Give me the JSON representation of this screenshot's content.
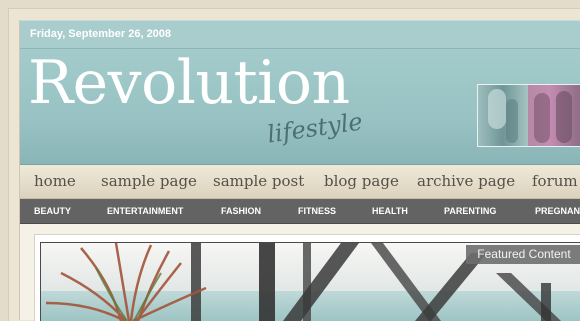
{
  "date": "Friday, September 26, 2008",
  "site": {
    "title": "Revolution",
    "tagline": "lifestyle"
  },
  "nav": {
    "items": [
      "home",
      "sample page",
      "sample post",
      "blog page",
      "archive page",
      "forum"
    ]
  },
  "categories": {
    "items": [
      "BEAUTY",
      "ENTERTAINMENT",
      "FASHION",
      "FITNESS",
      "HEALTH",
      "PARENTING",
      "PREGNAN"
    ]
  },
  "featured": {
    "label": "Featured Content"
  },
  "colors": {
    "header": "#9cc5c6",
    "nav": "#e6dfcc",
    "catbar": "#636363"
  }
}
